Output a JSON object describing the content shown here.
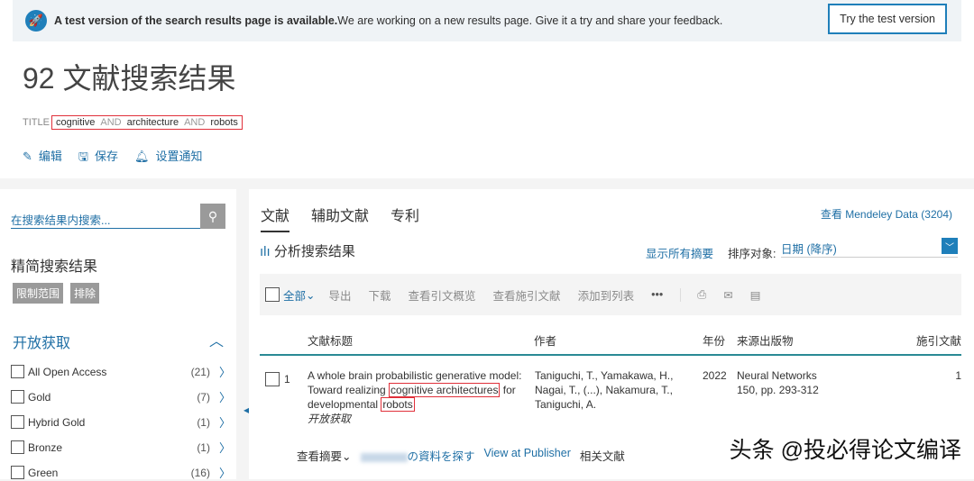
{
  "banner": {
    "bold": "A test version of the search results page is available.",
    "text": " We are working on a new results page. Give it a try and share your feedback.",
    "button": "Try the test version"
  },
  "title": "92 文献搜索结果",
  "query": {
    "field": "TITLE",
    "terms": [
      "cognitive",
      "AND",
      "architecture",
      "AND",
      "robots"
    ]
  },
  "actions": {
    "edit": "编辑",
    "save": "保存",
    "alert": "设置通知"
  },
  "sidebar": {
    "search_placeholder": "在搜索结果内搜索...",
    "refine": "精简搜索结果",
    "limit": "限制范围",
    "exclude": "排除",
    "open_access": "开放获取",
    "facets": [
      {
        "label": "All Open Access",
        "count": "(21)"
      },
      {
        "label": "Gold",
        "count": "(7)"
      },
      {
        "label": "Hybrid Gold",
        "count": "(1)"
      },
      {
        "label": "Bronze",
        "count": "(1)"
      },
      {
        "label": "Green",
        "count": "(16)"
      }
    ]
  },
  "tabs": [
    "文献",
    "辅助文献",
    "专利"
  ],
  "mendeley": "查看 Mendeley Data (3204)",
  "analyze": "分析搜索结果",
  "show_all_abstracts": "显示所有摘要",
  "sort_label": "排序对象:",
  "sort_value": "日期 (降序)",
  "toolbar": {
    "all": "全部",
    "export": "导出",
    "download": "下载",
    "citation_overview": "查看引文概览",
    "cited_by": "查看施引文献",
    "add_to_list": "添加到列表",
    "more": "•••"
  },
  "columns": {
    "title": "文献标题",
    "authors": "作者",
    "year": "年份",
    "source": "来源出版物",
    "cited": "施引文献"
  },
  "results": [
    {
      "num": "1",
      "title_a": "A whole brain probabilistic generative model: Toward realizing ",
      "hl1": "cognitive architectures",
      "title_b": " for developmental ",
      "hl2": "robots",
      "oa": "开放获取",
      "authors": "Taniguchi, T., Yamakawa, H., Nagai, T., (...), Nakamura, T., Taniguchi, A.",
      "year": "2022",
      "source": "Neural Networks",
      "source_detail": "150, pp. 293-312",
      "cited": "1",
      "view_abstract": "查看摘要",
      "find": "の資料を探す",
      "publisher": "View at Publisher",
      "related": "相关文献"
    }
  ],
  "watermark": "头条 @投必得论文编译"
}
